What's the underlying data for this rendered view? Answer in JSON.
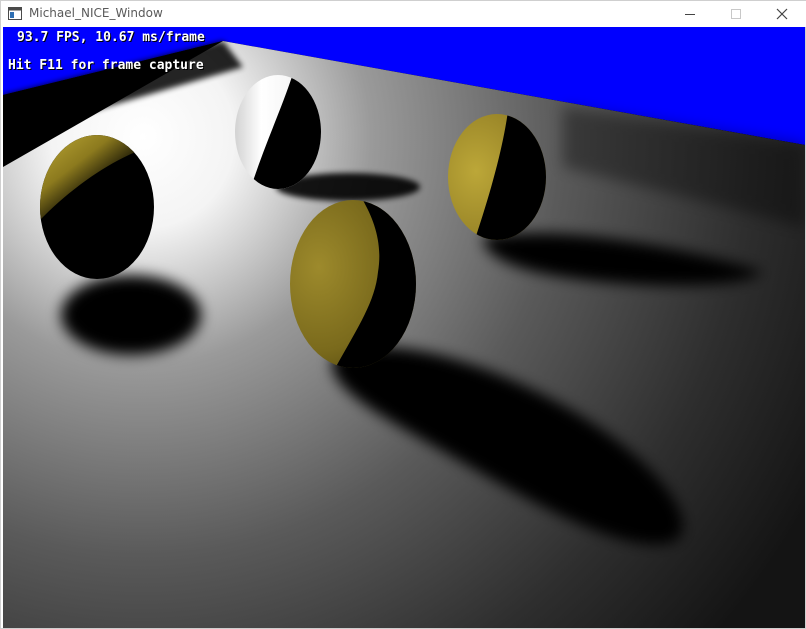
{
  "window": {
    "title": "Michael_NICE_Window",
    "app_icon": "window-app-icon",
    "controls": {
      "minimize_icon": "minimize-icon",
      "maximize_icon": "maximize-icon",
      "close_icon": "close-icon"
    }
  },
  "hud": {
    "fps_text": "93.7 FPS, 10.67 ms/frame",
    "capture_hint": "Hit F11 for frame capture"
  },
  "scene": {
    "sky_color": "#0000ff",
    "floor_light_color": "#ffffff",
    "floor_dark_color": "#1a1a1a",
    "sphere_color_gold": "#b5a22c",
    "sphere_color_white": "#f2f2f2",
    "objects": [
      "sphere-left",
      "sphere-back-white",
      "sphere-right-gold",
      "sphere-front-gold"
    ]
  }
}
